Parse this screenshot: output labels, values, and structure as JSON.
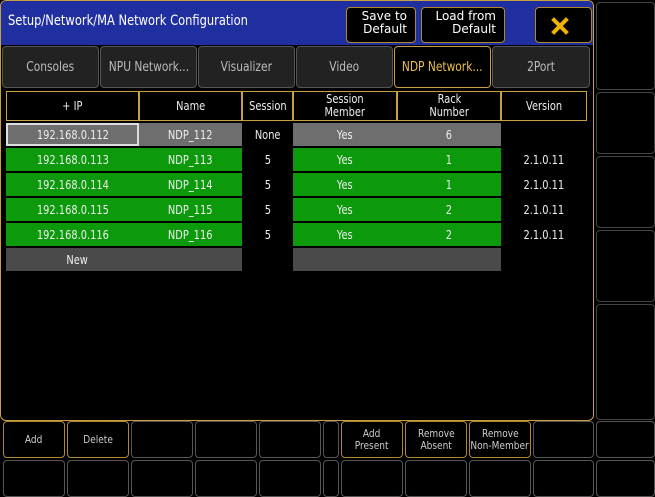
{
  "window": {
    "title": "Setup/Network/MA Network Configuration",
    "save_label_1": "Save to",
    "save_label_2": "Default",
    "load_label_1": "Load from",
    "load_label_2": "Default",
    "close_icon": "close-x-icon",
    "accent_color": "#c8a040",
    "close_color": "#f0b400"
  },
  "tabs": [
    {
      "label": "Consoles",
      "active": false
    },
    {
      "label": "NPU Network...",
      "active": false
    },
    {
      "label": "Visualizer",
      "active": false
    },
    {
      "label": "Video",
      "active": false
    },
    {
      "label": "NDP Network...",
      "active": true
    },
    {
      "label": "2Port",
      "active": false
    }
  ],
  "table": {
    "headers": {
      "ip": "+ IP",
      "name": "Name",
      "session": "Session",
      "session_member_1": "Session",
      "session_member_2": "Member",
      "rack_1": "Rack",
      "rack_2": "Number",
      "version": "Version"
    },
    "rows": [
      {
        "ip": "192.168.0.112",
        "name": "NDP_112",
        "session": "None",
        "member": "Yes",
        "rack": "6",
        "version": "",
        "selected": true
      },
      {
        "ip": "192.168.0.113",
        "name": "NDP_113",
        "session": "5",
        "member": "Yes",
        "rack": "1",
        "version": "2.1.0.11"
      },
      {
        "ip": "192.168.0.114",
        "name": "NDP_114",
        "session": "5",
        "member": "Yes",
        "rack": "1",
        "version": "2.1.0.11"
      },
      {
        "ip": "192.168.0.115",
        "name": "NDP_115",
        "session": "5",
        "member": "Yes",
        "rack": "2",
        "version": "2.1.0.11"
      },
      {
        "ip": "192.168.0.116",
        "name": "NDP_116",
        "session": "5",
        "member": "Yes",
        "rack": "2",
        "version": "2.1.0.11"
      }
    ],
    "new_row_label": "New",
    "row_color_green": "#0c9a0c",
    "row_color_gray": "#6e6e6e"
  },
  "bottom": {
    "add": "Add",
    "delete": "Delete",
    "add_present_1": "Add",
    "add_present_2": "Present",
    "remove_absent_1": "Remove",
    "remove_absent_2": "Absent",
    "remove_nonmember_1": "Remove",
    "remove_nonmember_2": "Non-Member"
  }
}
